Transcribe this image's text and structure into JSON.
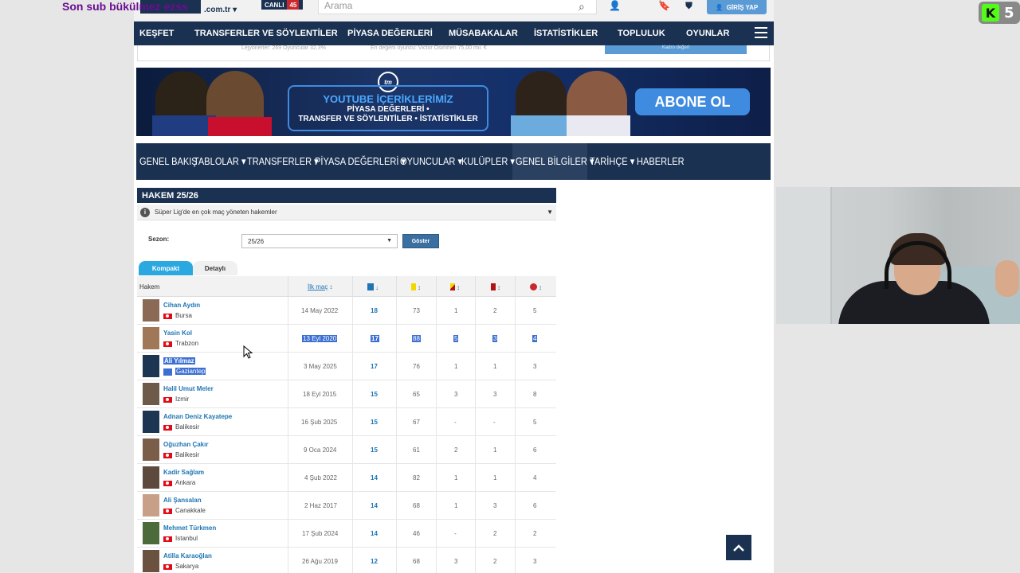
{
  "overlay": {
    "stream_title": "Son sub bükülmez ezss",
    "kick_count": "5",
    "kick_letter": "K"
  },
  "topbar": {
    "logo_domain": ".com.tr ▾",
    "live_label": "CANLI",
    "live_count": "45",
    "search_placeholder": "Arama",
    "login_label": "GİRİŞ YAP"
  },
  "mainnav": {
    "items": [
      "KEŞFET",
      "TRANSFERLER VE SÖYLENTİLER",
      "PİYASA DEĞERLERİ",
      "MÜSABAKALAR",
      "İSTATİSTİKLER",
      "TOPLULUK",
      "OYUNLAR"
    ]
  },
  "strip": {
    "left_text": "Lejyonerler: 269 Oyuncular  32,3%",
    "mid_text": "En değerli oyuncu: Victor Osimhen  75,00 mil. €",
    "button": "Kadro değeri"
  },
  "banner": {
    "logo": "tm",
    "title": "YOUTUBE İÇERİKLERİMİZ",
    "line1": "PİYASA DEĞERLERİ •",
    "line2": "TRANSFER VE SÖYLENTİLER • İSTATİSTİKLER",
    "cta": "ABONE OL"
  },
  "subnav": {
    "items": [
      "GENEL BAKIŞ",
      "TABLOLAR ▾",
      "TRANSFERLER ▾",
      "PİYASA DEĞERLERİ ▾",
      "OYUNCULAR ▾",
      "KULÜPLER ▾",
      "GENEL BİLGİLER ▾",
      "TARİHÇE ▾",
      "HABERLER"
    ]
  },
  "panel": {
    "title": "HAKEM 25/26",
    "info": "Süper Lig'de en çok maç yöneten hakemler",
    "season_label": "Sezon:",
    "season_value": "25/26",
    "show_button": "Göster",
    "tab_compact": "Kompakt",
    "tab_detailed": "Detaylı"
  },
  "table": {
    "headers": {
      "referee": "Hakem",
      "first_match": "İlk maç",
      "sort_icon": "↕",
      "sort_down": "↓"
    },
    "colors": {
      "yellow": "#f3d800",
      "red": "#b01515",
      "penalty": "#c9282d"
    },
    "rows": [
      {
        "name": "Cihan Aydın",
        "city": "Bursa",
        "first": "14 May 2022",
        "matches": "18",
        "yellow": "73",
        "yr": "1",
        "red": "2",
        "pen": "5"
      },
      {
        "name": "Yasin Kol",
        "city": "Trabzon",
        "first": "13 Eyl 2020",
        "matches": "17",
        "yellow": "88",
        "yr": "5",
        "red": "3",
        "pen": "4"
      },
      {
        "name": "Ali Yılmaz",
        "city": "Gaziantep",
        "first": "3 May 2025",
        "matches": "17",
        "yellow": "76",
        "yr": "1",
        "red": "1",
        "pen": "3"
      },
      {
        "name": "Halil Umut Meler",
        "city": "Izmir",
        "first": "18 Eyl 2015",
        "matches": "15",
        "yellow": "65",
        "yr": "3",
        "red": "3",
        "pen": "8"
      },
      {
        "name": "Adnan Deniz Kayatepe",
        "city": "Balikesir",
        "first": "16 Şub 2025",
        "matches": "15",
        "yellow": "67",
        "yr": "-",
        "red": "-",
        "pen": "5"
      },
      {
        "name": "Oğuzhan Çakır",
        "city": "Balikesir",
        "first": "9 Oca 2024",
        "matches": "15",
        "yellow": "61",
        "yr": "2",
        "red": "1",
        "pen": "6"
      },
      {
        "name": "Kadir Sağlam",
        "city": "Ankara",
        "first": "4 Şub 2022",
        "matches": "14",
        "yellow": "82",
        "yr": "1",
        "red": "1",
        "pen": "4"
      },
      {
        "name": "Ali Şansalan",
        "city": "Canakkale",
        "first": "2 Haz 2017",
        "matches": "14",
        "yellow": "68",
        "yr": "1",
        "red": "3",
        "pen": "6"
      },
      {
        "name": "Mehmet Türkmen",
        "city": "Istanbul",
        "first": "17 Şub 2024",
        "matches": "14",
        "yellow": "46",
        "yr": "-",
        "red": "2",
        "pen": "2"
      },
      {
        "name": "Atilla Karaoğlan",
        "city": "Sakarya",
        "first": "26 Ağu 2019",
        "matches": "12",
        "yellow": "68",
        "yr": "3",
        "red": "2",
        "pen": "3"
      }
    ]
  }
}
